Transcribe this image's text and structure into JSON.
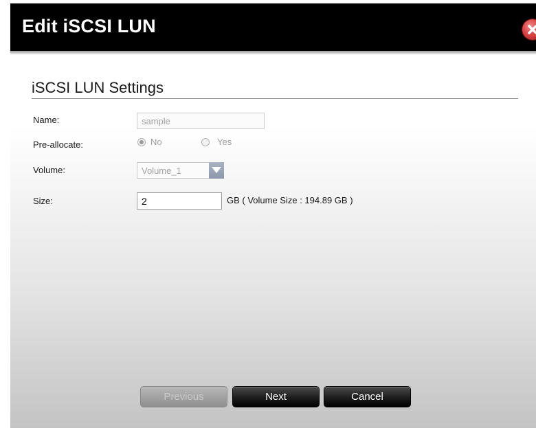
{
  "dialog": {
    "title": "Edit iSCSI LUN",
    "close_icon": "close-icon"
  },
  "section": {
    "title": "iSCSI LUN Settings"
  },
  "form": {
    "name_label": "Name:",
    "name_value": "sample",
    "preallocate_label": "Pre-allocate:",
    "preallocate_options": [
      "No",
      "Yes"
    ],
    "preallocate_selected": "No",
    "volume_label": "Volume:",
    "volume_value": "Volume_1",
    "size_label": "Size:",
    "size_value": "2",
    "size_unit": "GB ( Volume Size : 194.89 GB )"
  },
  "buttons": {
    "previous": "Previous",
    "next": "Next",
    "cancel": "Cancel"
  },
  "colors": {
    "titlebar": "#000000",
    "close_button": "#d94545",
    "button_dark": "#1d1d1d"
  }
}
